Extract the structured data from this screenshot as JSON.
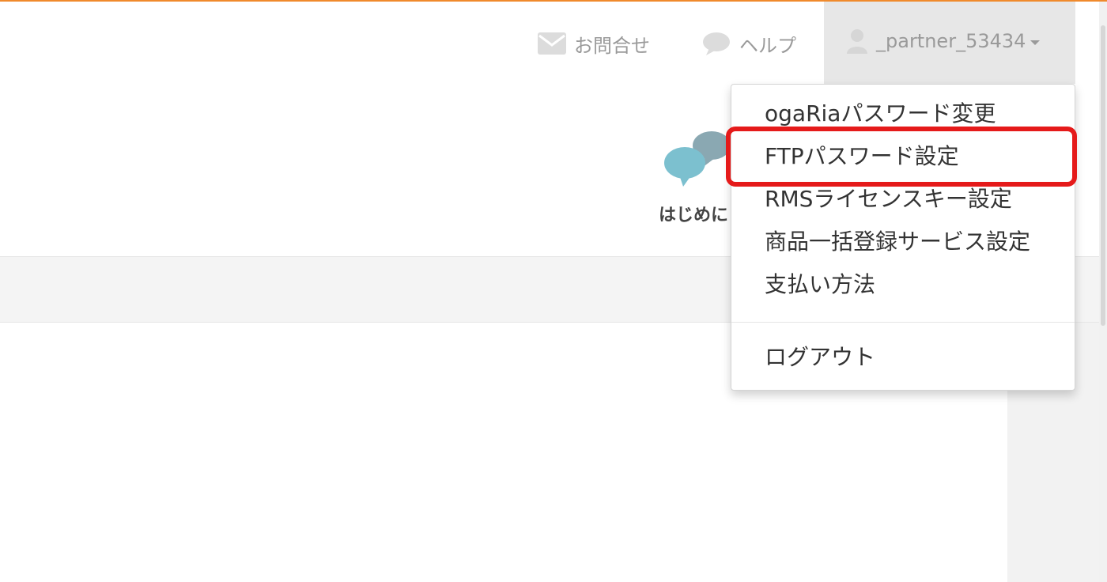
{
  "header": {
    "nav": {
      "contact_label": "お問合せ",
      "help_label": "ヘルプ"
    },
    "user": {
      "name": "_partner_53434"
    },
    "hajime_label": "はじめに"
  },
  "dropdown": {
    "items": [
      {
        "label": "ogaRiaパスワード変更"
      },
      {
        "label": "FTPパスワード設定"
      },
      {
        "label": "RMSライセンスキー設定"
      },
      {
        "label": "商品一括登録サービス設定"
      },
      {
        "label": "支払い方法"
      }
    ],
    "logout_label": "ログアウト"
  },
  "icons": {
    "contact": "mail-icon",
    "help": "speech-bubble-icon",
    "user": "user-icon",
    "hajime": "chat-bubbles-icon"
  },
  "colors": {
    "accent_top": "#f08a2c",
    "highlight": "#e51a1a",
    "bubble_front": "#7cc0cf",
    "bubble_back": "#8aa8b2"
  }
}
